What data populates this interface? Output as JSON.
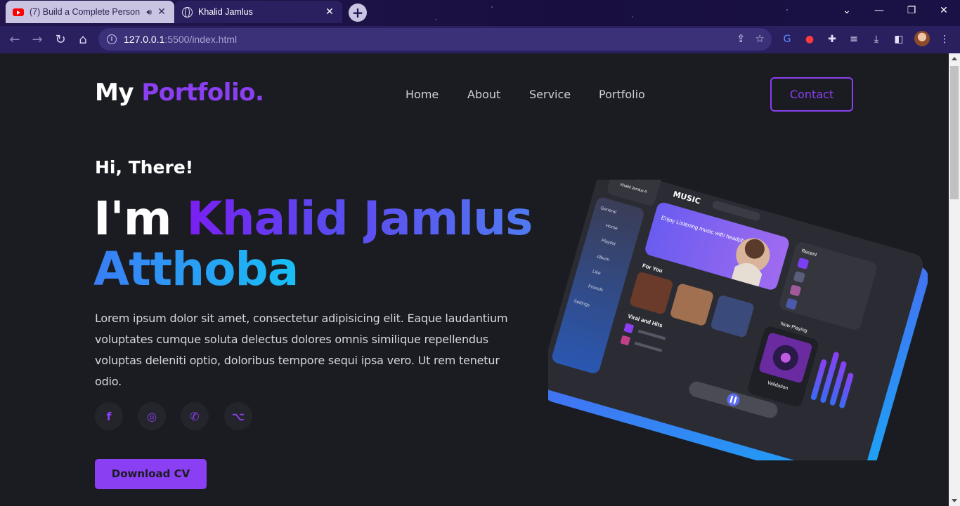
{
  "browser": {
    "tabs": [
      {
        "title": "(7) Build a Complete Person",
        "icon": "youtube-icon",
        "active": false
      },
      {
        "title": "Khalid Jamlus",
        "icon": "globe-icon",
        "active": true
      }
    ],
    "url_host": "127.0.0.1",
    "url_rest": ":5500/index.html"
  },
  "header": {
    "logo_main": "My",
    "logo_accent": "Portfolio.",
    "nav": [
      "Home",
      "About",
      "Service",
      "Portfolio"
    ],
    "contact_label": "Contact"
  },
  "hero": {
    "greeting": "Hi, There!",
    "im": "I'm",
    "name_first": "Khalid",
    "name_middle": "Jamlus",
    "name_last": "Atthoba",
    "bio": "Lorem ipsum dolor sit amet, consectetur adipisicing elit. Eaque laudantium voluptates cumque soluta delectus dolores omnis similique repellendus voluptas deleniti optio, doloribus tempore sequi ipsa vero. Ut rem tenetur odio.",
    "socials": [
      {
        "name": "facebook-icon",
        "glyph": "f"
      },
      {
        "name": "instagram-icon",
        "glyph": "◎"
      },
      {
        "name": "whatsapp-icon",
        "glyph": "✆"
      },
      {
        "name": "github-icon",
        "glyph": "⌥"
      }
    ],
    "download_label": "Download CV"
  },
  "mockup": {
    "brand": "MUSIC",
    "banner_title": "Enjoy Listening music with headphone",
    "profile_name": "Khalid Jamlus A",
    "menu_group": "General",
    "menu": [
      "Home",
      "Playlist",
      "Album",
      "Like",
      "Friends",
      "Settings"
    ],
    "for_you": "For You",
    "viral": "Viral and Hits",
    "recent": "Recent",
    "now_playing": "Now Playing",
    "track": "Validation"
  },
  "colors": {
    "accent": "#8b3ff2",
    "background": "#1b1c21"
  }
}
